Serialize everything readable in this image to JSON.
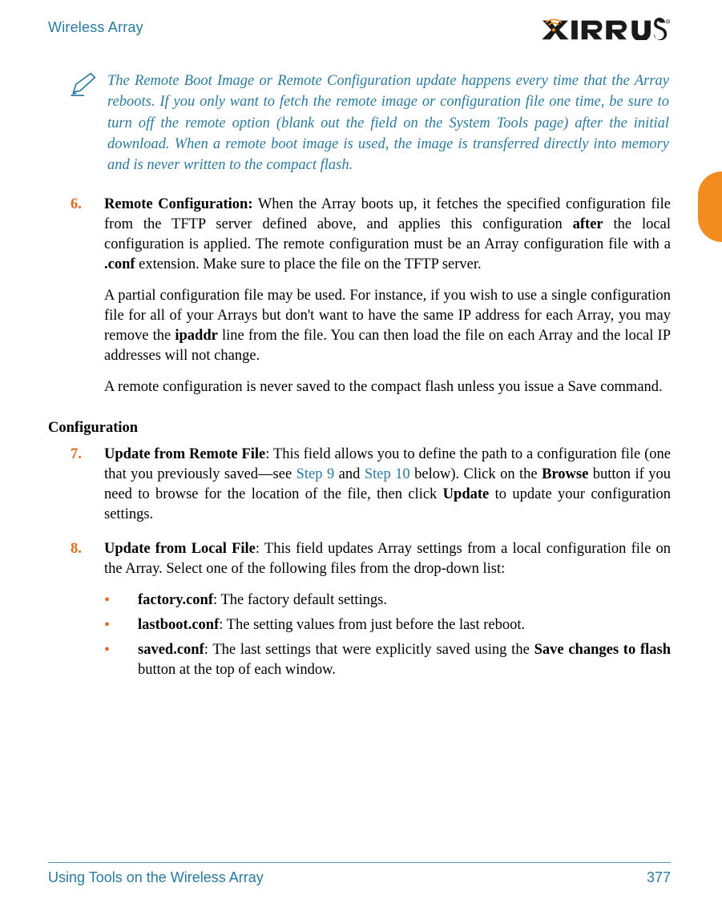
{
  "header": {
    "title": "Wireless Array",
    "logo_alt": "XIRRUS"
  },
  "note": {
    "text": "The Remote Boot Image or Remote Configuration update happens every time that the Array reboots. If you only want to fetch the remote image or configuration file one time, be sure to turn off the remote option (blank out the field on the System Tools page) after the initial download. When a remote boot image is used, the image is transferred directly into memory and is never written to the compact flash."
  },
  "step6": {
    "num": "6.",
    "label": "Remote Configuration:",
    "p1a": " When the Array boots up, it fetches the specified configuration file from the TFTP server defined above, and applies this configuration ",
    "after": "after",
    "p1b": " the local configuration is applied. The remote configuration must be an Array configuration file with a ",
    "conf": ".conf",
    "p1c": " extension. Make sure to place the file on the TFTP server.",
    "p2a": "A partial configuration file may be used. For instance, if you wish to use a single configuration file for all of your Arrays but don't want to have the same IP address for each Array, you may remove the ",
    "ipaddr": "ipaddr",
    "p2b": " line from the file. You can then load the file on each Array and the local IP addresses will not change.",
    "p3": "A remote configuration is never saved to the compact flash unless you issue a Save command."
  },
  "section": {
    "heading": "Configuration"
  },
  "step7": {
    "num": "7.",
    "label": "Update from Remote File",
    "p1a": ": This field allows you to define the path to a configuration file (one that you previously saved—see ",
    "link1": "Step 9",
    "and": " and ",
    "link2": "Step 10",
    "p1b": " below). Click on the ",
    "browse": "Browse",
    "p1c": " button if you need to browse for the location of the file, then click ",
    "update": "Update",
    "p1d": " to update your configuration settings."
  },
  "step8": {
    "num": "8.",
    "label": "Update from Local File",
    "text": ": This field updates Array settings from a local configuration file on the Array. Select one of the following files from the drop-down list:"
  },
  "bullets": [
    {
      "label": "factory.conf",
      "text": ": The factory default settings."
    },
    {
      "label": "lastboot.conf",
      "text": ": The setting values from just before the last reboot."
    },
    {
      "label": "saved.conf",
      "text_a": ": The last settings that were explicitly saved using the ",
      "bold": "Save changes to flash",
      "text_b": " button at the top of each window."
    }
  ],
  "footer": {
    "left": "Using Tools on the Wireless Array",
    "right": "377"
  }
}
